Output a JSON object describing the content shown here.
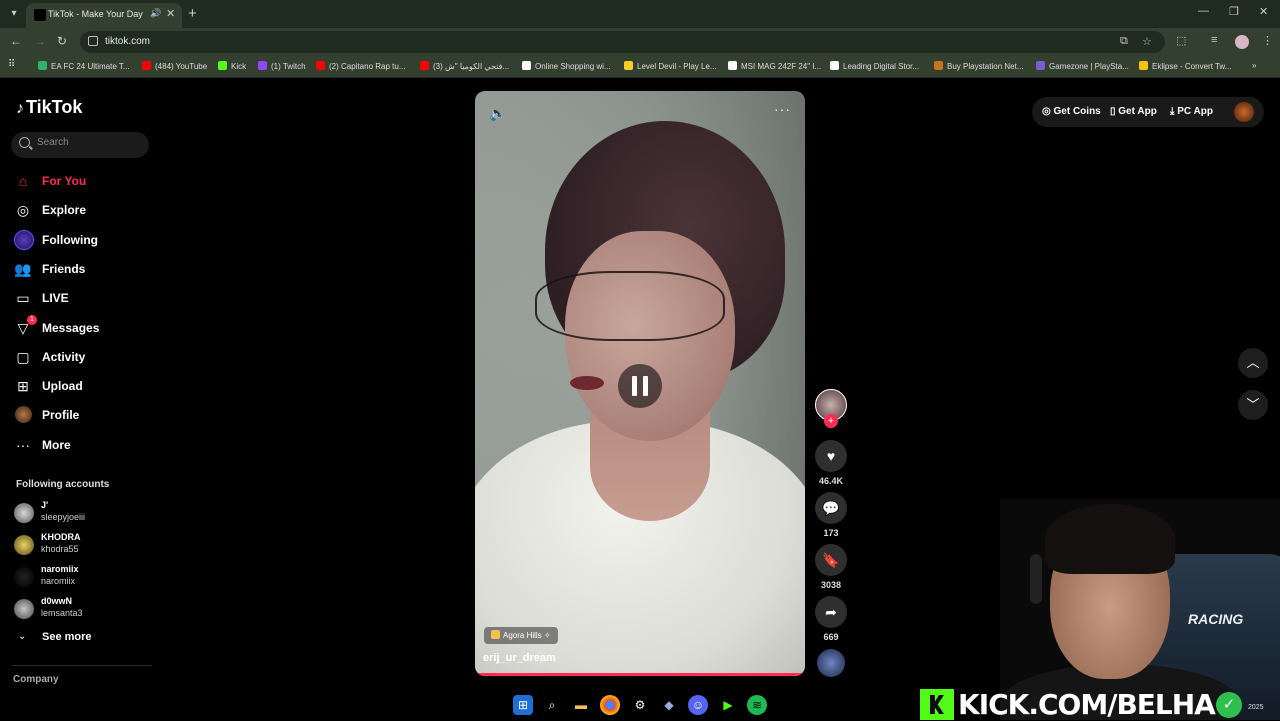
{
  "browser": {
    "tab_title": "TikTok - Make Your Day",
    "url": "tiktok.com",
    "bookmarks": [
      {
        "label": "EA FC 24 Ultimate T...",
        "color": "#2fb36a"
      },
      {
        "label": "(484) YouTube",
        "color": "#ff0000"
      },
      {
        "label": "Kick",
        "color": "#53fc18"
      },
      {
        "label": "(1) Twitch",
        "color": "#9146ff"
      },
      {
        "label": "(2) Capitano Rap tu...",
        "color": "#ff0000"
      },
      {
        "label": "(3) فتحي الكوميا \"ش...",
        "color": "#ff0000"
      },
      {
        "label": "Online Shopping wi...",
        "color": "#ffffff"
      },
      {
        "label": "Level Devil - Play Le...",
        "color": "#f5d020"
      },
      {
        "label": "MSI MAG 242F 24\" I...",
        "color": "#ffffff"
      },
      {
        "label": "Leading Digital Stor...",
        "color": "#ffffff"
      },
      {
        "label": "Buy Playstation Net...",
        "color": "#c8741c"
      },
      {
        "label": "Gamezone | PlaySta...",
        "color": "#7b5cd6"
      },
      {
        "label": "Eklipse - Convert Tw...",
        "color": "#f5c400"
      }
    ]
  },
  "tiktok": {
    "logo": "TikTok",
    "search_placeholder": "Search",
    "nav": [
      {
        "label": "For You",
        "icon": "home-icon",
        "active": true
      },
      {
        "label": "Explore",
        "icon": "compass-icon"
      },
      {
        "label": "Following",
        "icon": "following-icon"
      },
      {
        "label": "Friends",
        "icon": "friends-icon"
      },
      {
        "label": "LIVE",
        "icon": "live-icon"
      },
      {
        "label": "Messages",
        "icon": "messages-icon",
        "badge": "1"
      },
      {
        "label": "Activity",
        "icon": "activity-icon"
      },
      {
        "label": "Upload",
        "icon": "upload-icon"
      },
      {
        "label": "Profile",
        "icon": "profile-icon"
      },
      {
        "label": "More",
        "icon": "more-icon"
      }
    ],
    "following_title": "Following accounts",
    "accounts": [
      {
        "name": "J'",
        "handle": "sleepyjoeiii"
      },
      {
        "name": "KHODRA",
        "handle": "khodra55"
      },
      {
        "name": "naromiix",
        "handle": "naromiix"
      },
      {
        "name": "d0wwN",
        "handle": "lemsanta3"
      }
    ],
    "see_more": "See more",
    "company": "Company",
    "topbar": {
      "coins": "Get Coins",
      "app": "Get App",
      "pc": "PC App"
    },
    "video": {
      "location": "Agora Hills",
      "author": "erij_ur_dream",
      "likes": "46.4K",
      "comments": "173",
      "saves": "3038",
      "shares": "669"
    }
  },
  "stream": {
    "kick_text": "KICK.COM/BELHA",
    "chair_text": "RACING",
    "year": "2025"
  }
}
